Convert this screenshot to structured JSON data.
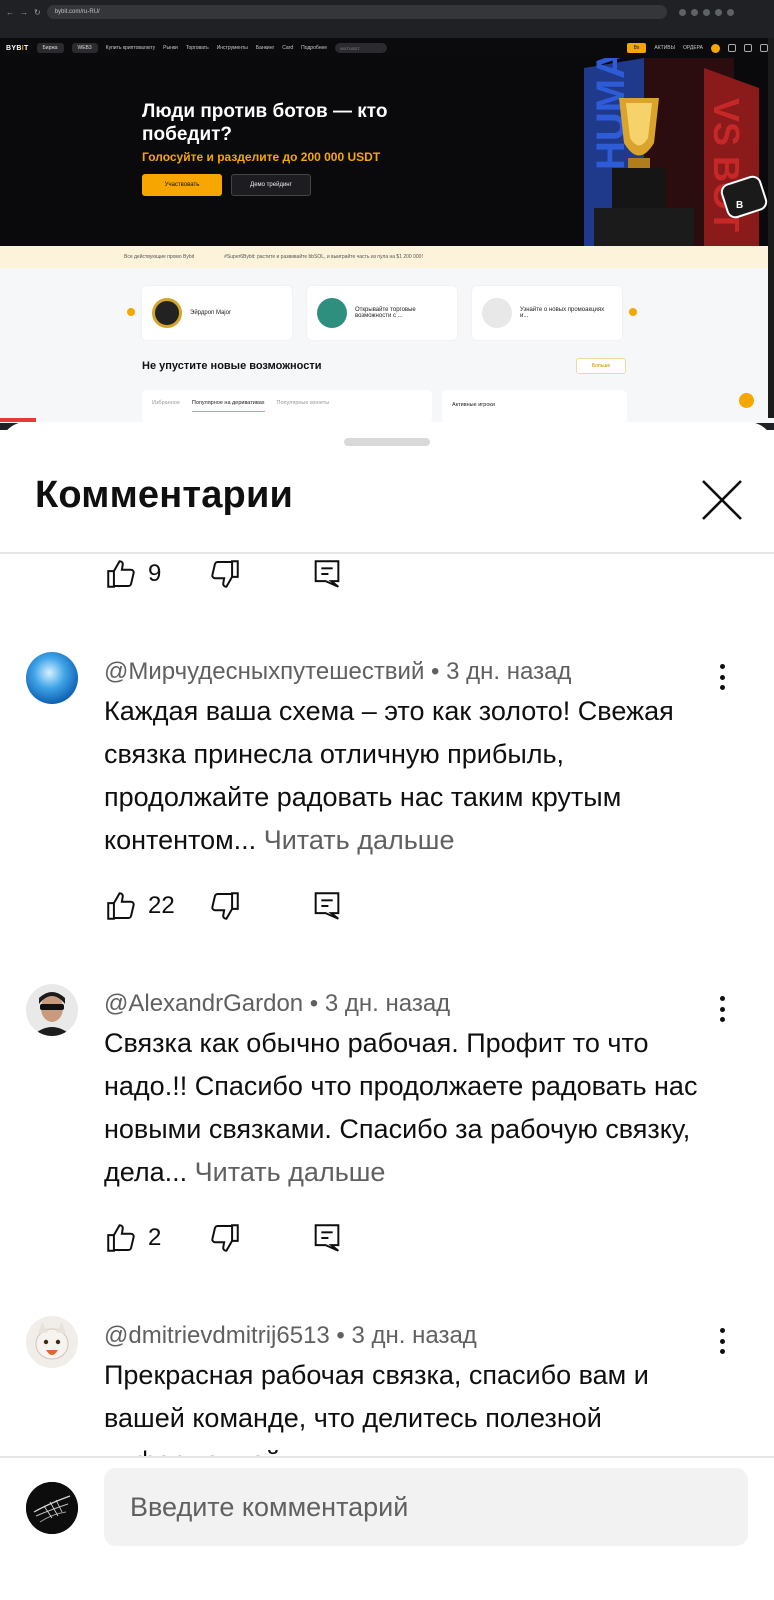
{
  "browser": {
    "url": "bybit.com/ru-RU/"
  },
  "site": {
    "logo": "BYBIT",
    "nav_pills": [
      "Биржа",
      "WEB3"
    ],
    "nav_items": [
      "Купить криптовалюту",
      "Рынки",
      "Торговать",
      "Инструменты",
      "Банкинг",
      "Card",
      "Подробнее"
    ],
    "search_placeholder": "WXTUSDT",
    "signup_label": "Вх",
    "assets_label": "АКТИВЫ",
    "orders_label": "ОРДЕРА",
    "hero": {
      "title": "Люди против ботов — кто победит?",
      "subtitle": "Голосуйте и разделите до 200 000 USDT",
      "primary_button": "Участвовать",
      "secondary_button": "Демо трейдинг"
    },
    "ticker": [
      "Все действующие промо Bybit",
      "#Super6Bybit: растите и развивайте bbSOL, и выиграйте часть из пула на $1 200 000!"
    ],
    "promos": [
      "Эйрдроп Major",
      "Открывайте торговые возможности с ...",
      "Узнайте о новых промоакциях и..."
    ],
    "section_title": "Не упустите новые возможности",
    "more_button": "Больше",
    "tabs": [
      "Избранное",
      "Популярное на деривативах",
      "Популярные монеты"
    ],
    "players_label": "Активные игроки"
  },
  "sheet": {
    "title": "Комментарии",
    "close_icon": "close-icon"
  },
  "comments": [
    {
      "likes": "9"
    },
    {
      "author": "@Мирчудесныхпутешествий",
      "time": "3 дн. назад",
      "text": "Каждая ваша схема – это как золото! Свежая связка принесла отличную прибыль, продолжайте радовать нас таким крутым контентом...",
      "read_more": "Читать дальше",
      "likes": "22"
    },
    {
      "author": "@AlexandrGardon",
      "time": "3 дн. назад",
      "text": "Связка как обычно рабочая. Профит то что надо.!! Спасибо что продолжаете радовать нас новыми связками. Спасибо за рабочую связку, дела...",
      "read_more": "Читать дальше",
      "likes": "2"
    },
    {
      "author": "@dmitrievdmitrij6513",
      "time": "3 дн. назад",
      "text": "Прекрасная рабочая связка, спасибо вам и вашей команде, что делитесь полезной информацией."
    }
  ],
  "composer": {
    "placeholder": "Введите комментарий"
  },
  "colors": {
    "accent": "#f7a600",
    "text_primary": "#0f0f0f",
    "text_secondary": "#606060"
  }
}
